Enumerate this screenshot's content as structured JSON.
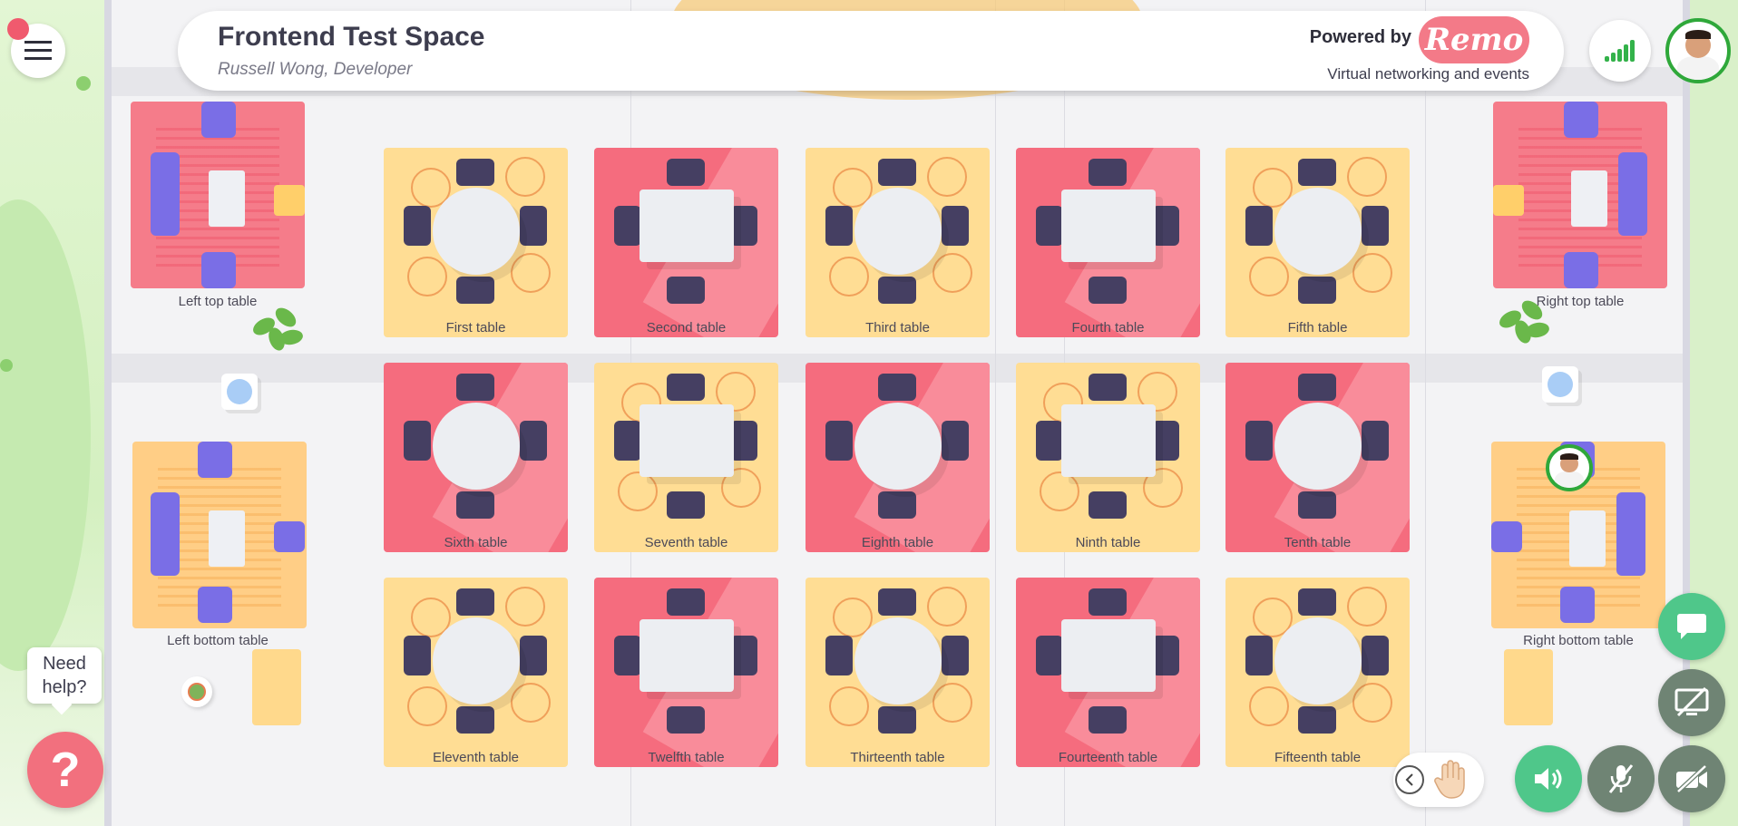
{
  "header": {
    "title": "Frontend Test Space",
    "subtitle": "Russell Wong, Developer",
    "powered_by": "Powered by",
    "brand": "Remo",
    "tagline": "Virtual networking and events"
  },
  "tables": [
    {
      "label": "First table",
      "color": "yellow",
      "shape": "round"
    },
    {
      "label": "Second table",
      "color": "red",
      "shape": "square"
    },
    {
      "label": "Third table",
      "color": "yellow",
      "shape": "round"
    },
    {
      "label": "Fourth table",
      "color": "red",
      "shape": "square"
    },
    {
      "label": "Fifth table",
      "color": "yellow",
      "shape": "round"
    },
    {
      "label": "Sixth table",
      "color": "red",
      "shape": "round"
    },
    {
      "label": "Seventh table",
      "color": "yellow",
      "shape": "square"
    },
    {
      "label": "Eighth table",
      "color": "red",
      "shape": "round"
    },
    {
      "label": "Ninth table",
      "color": "yellow",
      "shape": "square"
    },
    {
      "label": "Tenth table",
      "color": "red",
      "shape": "round"
    },
    {
      "label": "Eleventh table",
      "color": "yellow",
      "shape": "round"
    },
    {
      "label": "Twelfth table",
      "color": "red",
      "shape": "square"
    },
    {
      "label": "Thirteenth table",
      "color": "yellow",
      "shape": "round"
    },
    {
      "label": "Fourteenth table",
      "color": "red",
      "shape": "square"
    },
    {
      "label": "Fifteenth table",
      "color": "yellow",
      "shape": "round"
    }
  ],
  "lounges": {
    "left_top": "Left top table",
    "right_top": "Right top table",
    "left_bottom": "Left bottom table",
    "right_bottom": "Right bottom table"
  },
  "help": {
    "bubble_line1": "Need",
    "bubble_line2": "help?",
    "button_glyph": "?"
  },
  "icons": {
    "menu": "hamburger-icon",
    "signal": "signal-strength-icon",
    "chat": "chat-icon",
    "screen_share": "screen-share-off-icon",
    "speaker": "speaker-icon",
    "mic": "mic-off-icon",
    "camera": "camera-off-icon",
    "hand": "raise-hand-icon",
    "chevron": "chevron-left-icon"
  },
  "colors": {
    "brand": "#f37a88",
    "table_yellow": "#ffdd94",
    "table_red": "#f56c7e",
    "control_green": "#4fc78a",
    "control_gray": "#6f8474",
    "avatar_ring": "#2fa83a"
  }
}
